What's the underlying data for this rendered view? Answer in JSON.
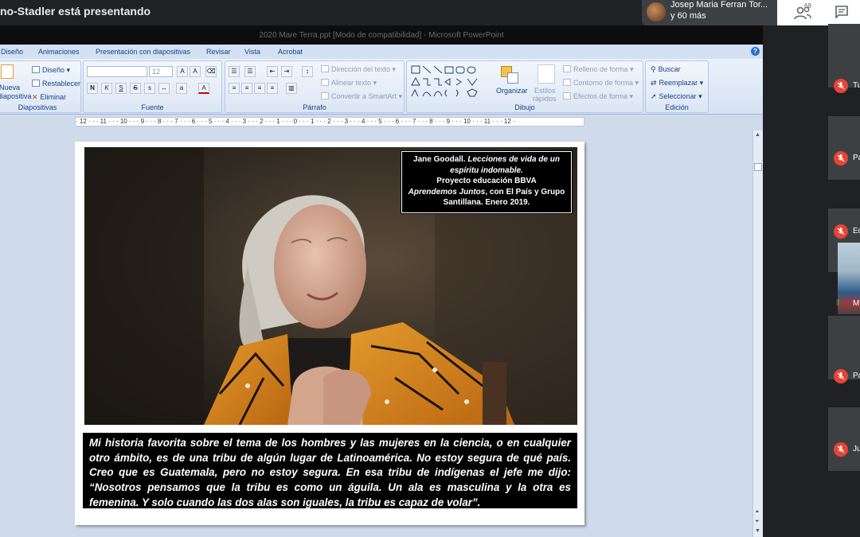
{
  "meet": {
    "presenter_text": "no-Stadler está presentando",
    "pinned_name": "Josep Maria Ferran Tor...",
    "pinned_more": "y 60 más",
    "people_count": "68",
    "participants": [
      {
        "name": "Tu"
      },
      {
        "name": "Pa"
      },
      {
        "name": "Ed"
      },
      {
        "name": "M"
      },
      {
        "name": "Pa"
      },
      {
        "name": "Ju"
      }
    ],
    "colors": {
      "mic_off": "#ea4335",
      "bar": "#202124"
    }
  },
  "ppt": {
    "window_title": "2020 Mare Terra.ppt [Modo de compatibilidad] - Microsoft PowerPoint",
    "tabs": [
      "Diseño",
      "Animaciones",
      "Presentación con diapositivas",
      "Revisar",
      "Vista",
      "Acrobat"
    ],
    "ribbon": {
      "slides": {
        "new_slide": "Nueva",
        "new_slide_2": "diapositiva",
        "layout": "Diseño",
        "reset": "Restablecer",
        "delete": "Eliminar",
        "label": "Diapositivas"
      },
      "font": {
        "size": "12",
        "label": "Fuente"
      },
      "paragraph": {
        "text_direction": "Dirección del texto",
        "align_text": "Alinear texto",
        "smartart": "Convertir a SmartArt",
        "label": "Párrafo"
      },
      "drawing": {
        "arrange": "Organizar",
        "quick_styles": "Estilos",
        "quick_styles_2": "rápidos",
        "shape_fill": "Relleno de forma",
        "shape_outline": "Contorno de forma",
        "shape_effects": "Efectos de forma",
        "label": "Dibujo"
      },
      "editing": {
        "find": "Buscar",
        "replace": "Reemplazar",
        "select": "Seleccionar",
        "label": "Edición"
      }
    },
    "ruler": "· 12 · · · 11 · · · 10 · · · 9 · · · 8 · · · 7 · · · 6 · · · 5 · · · 4 · · · 3 · · · 2 · · · 1 · · · 0 · · · 1 · · · 2 · · · 3 · · · 4 · · · 5 · · · 6 · · · 7 · · · 8 · · · 9 · · · 10 · · · 11 · · · 12 ·"
  },
  "slide": {
    "credit": {
      "line1a": "Jane Goodall. ",
      "line1b": "Lecciones de vida de un espíritu indomable.",
      "line2": "Proyecto educación BBVA",
      "line3a": "Aprendemos Juntos",
      "line3b": ", con El País y Grupo Santillana. Enero 2019."
    },
    "quote": "Mi historia favorita sobre el tema de los hombres y las mujeres en la ciencia, o en cualquier otro ámbito, es de una tribu de algún lugar de Latinoamérica. No estoy segura de qué país. Creo que es Guatemala, pero no estoy segura. En esa tribu de indígenas el jefe me dijo: “Nosotros pensamos que la tribu es como un águila. Un ala es masculina y la otra es femenina. Y solo cuando las dos alas son iguales, la tribu es capaz de volar”."
  }
}
